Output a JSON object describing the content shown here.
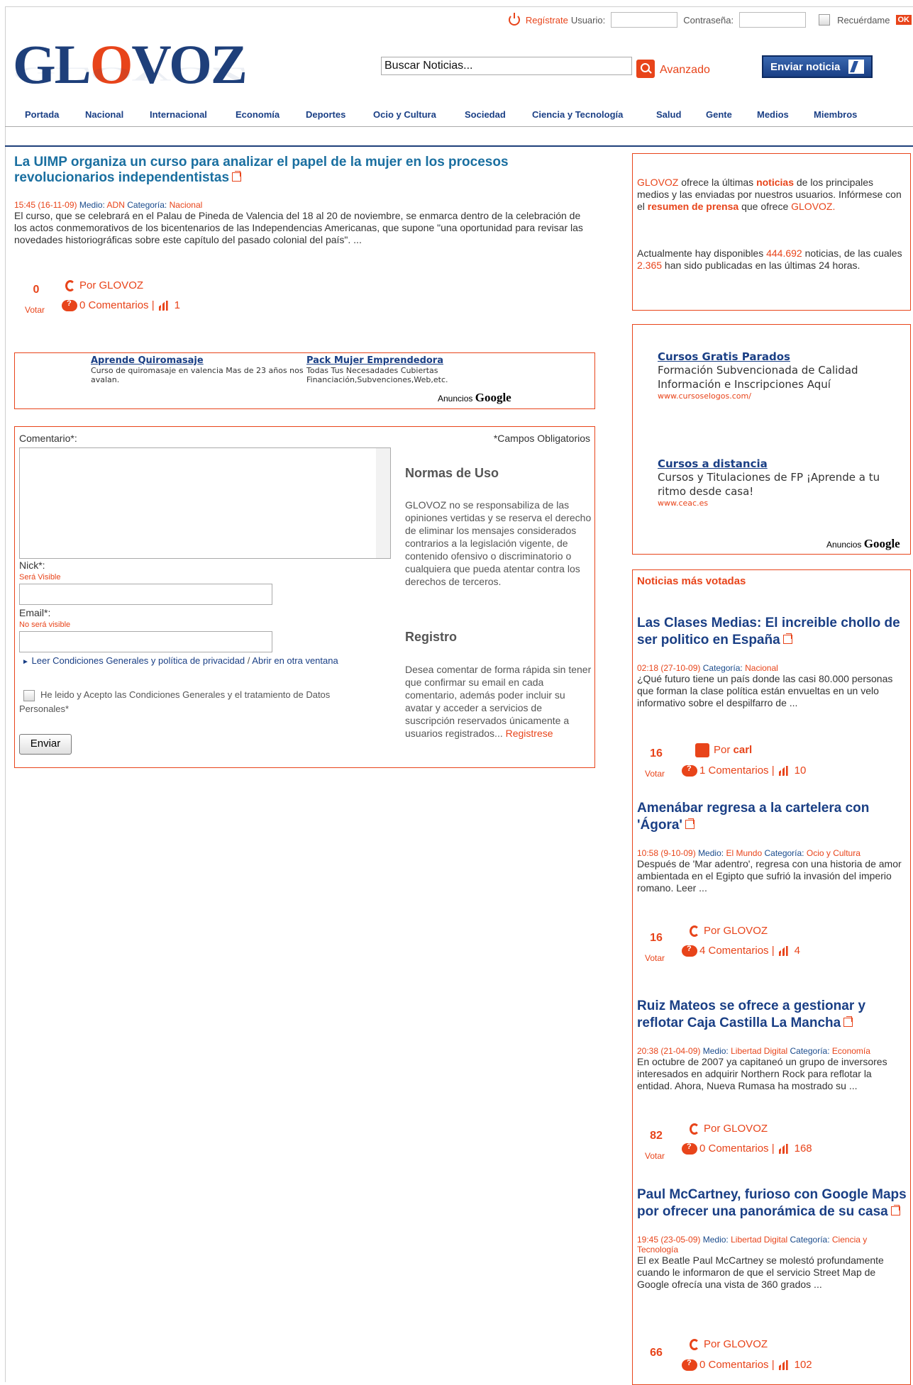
{
  "login": {
    "register": "Regístrate",
    "user_label": "Usuario:",
    "pass_label": "Contraseña:",
    "remember": "Recuérdame",
    "ok": "OK"
  },
  "logo": {
    "pre": "GL",
    "o": "O",
    "post": "VOZ"
  },
  "search": {
    "placeholder": "Buscar Noticias...",
    "advanced": "Avanzado",
    "send": "Enviar noticia"
  },
  "nav": [
    "Portada",
    "Nacional",
    "Internacional",
    "Economía",
    "Deportes",
    "Ocio y Cultura",
    "Sociedad",
    "Ciencia y Tecnología",
    "Salud",
    "Gente",
    "Medios",
    "Miembros"
  ],
  "article": {
    "title": "La UIMP organiza un curso para analizar el papel de la mujer en los procesos revolucionarios independentistas",
    "time": "15:45 (16-11-09)",
    "medio_label": "Medio:",
    "medio": "ADN",
    "cat_label": "Categoría:",
    "category": "Nacional",
    "body": "El curso, que se celebrará en el Palau de Pineda de Valencia del 18 al 20 de noviembre, se enmarca dentro de la celebración de los actos conmemorativos de los bicentenarios de las Independencias Americanas, que supone \"una oportunidad para revisar las novedades historiográficas sobre este capítulo del pasado colonial del país\". ...",
    "votes": "0",
    "votar": "Votar",
    "by": "Por GLOVOZ",
    "comments": "0 Comentarios |",
    "views": "1"
  },
  "ads_main": {
    "ad1_title": "Aprende Quiromasaje",
    "ad1_desc": "Curso de quiromasaje en valencia Mas de 23 años nos avalan.",
    "ad2_title": "Pack Mujer Emprendedora",
    "ad2_desc": "Todas Tus Necesadades Cubiertas Financiación,Subvenciones,Web,etc.",
    "anuncios": "Anuncios",
    "google": "Google"
  },
  "form": {
    "comment_label": "Comentario*:",
    "required": "*Campos Obligatorios",
    "nick_label": "Nick*:",
    "nick_note": "Será Visible",
    "email_label": "Email*:",
    "email_note": "No será visible",
    "conditions": "Leer Condiciones Generales y política de privacidad",
    "open_window": "Abrir en otra ventana",
    "accept": "He leido y Acepto las Condiciones Generales y el tratamiento de Datos Personales",
    "submit": "Enviar",
    "rules_title": "Normas de Uso",
    "rules_text": "GLOVOZ no se responsabiliza de las opiniones vertidas y se reserva el derecho de eliminar los mensajes considerados contrarios a la legislación vigente, de contenido ofensivo o discriminatorio o cualquiera que pueda atentar contra los derechos de terceros.",
    "reg_title": "Registro",
    "reg_text": "Desea comentar de forma rápida sin tener que confirmar su email en cada comentario, además poder incluir su avatar y acceder a servicios de suscripción reservados únicamente a usuarios registrados...",
    "reg_link": "Registrese"
  },
  "info": {
    "p1a": "GLOVOZ",
    "p1b": " ofrece la últimas ",
    "p1c": "noticias",
    "p1d": " de los principales medios y las enviadas por nuestros usuarios. Infórmese con el ",
    "p1e": "resumen de prensa",
    "p1f": " que ofrece ",
    "p1g": "GLOVOZ.",
    "p2a": "Actualmente hay disponibles ",
    "p2b": "444.692",
    "p2c": " noticias, de las cuales ",
    "p2d": "2.365",
    "p2e": " han sido publicadas en las últimas 24 horas."
  },
  "ads_side": {
    "ad1_title": "Cursos Gratis Parados",
    "ad1_desc": "Formación Subvencionada de Calidad Información e Inscripciones Aquí",
    "ad1_url": "www.cursoselogos.com/",
    "ad2_title": "Cursos a distancia",
    "ad2_desc": "Cursos y Titulaciones de FP ¡Aprende a tu ritmo desde casa!",
    "ad2_url": "www.ceac.es",
    "anuncios": "Anuncios",
    "google": "Google"
  },
  "top": {
    "heading": "Noticias más votadas",
    "items": [
      {
        "title": "Las Clases Medias: El increible chollo de ser politico en España",
        "time": "02:18 (27-10-09)",
        "medio": "",
        "cat": "Nacional",
        "snippet": "¿Qué futuro tiene un país donde las casi 80.000 personas que forman la clase política están envueltas en un velo informativo sobre el despilfarro de ...",
        "votes": "16",
        "by": "Por ",
        "user": "carl",
        "comments": "1 Comentarios |",
        "views": "10"
      },
      {
        "title": "Amenábar regresa a la cartelera con 'Ágora'",
        "time": "10:58 (9-10-09)",
        "medio": "El Mundo",
        "cat": "Ocio y Cultura",
        "snippet": "Después de 'Mar adentro', regresa con una historia de amor ambientada en el Egipto que sufrió la invasión del imperio romano.  Leer ...",
        "votes": "16",
        "by": "Por GLOVOZ",
        "user": "",
        "comments": "4 Comentarios |",
        "views": "4"
      },
      {
        "title": "Ruiz Mateos se ofrece a gestionar y reflotar Caja Castilla La Mancha",
        "time": "20:38 (21-04-09)",
        "medio": "Libertad Digital",
        "cat": "Economía",
        "snippet": "En octubre de 2007 ya capitaneó un grupo de inversores interesados en adquirir Northern Rock para reflotar la entidad. Ahora, Nueva Rumasa ha mostrado su ...",
        "votes": "82",
        "by": "Por GLOVOZ",
        "user": "",
        "comments": "0 Comentarios |",
        "views": "168"
      },
      {
        "title": "Paul McCartney, furioso con Google Maps por ofrecer una panorámica de su casa",
        "time": "19:45 (23-05-09)",
        "medio": "Libertad Digital",
        "cat": "Ciencia y Tecnología",
        "snippet": "El ex Beatle Paul McCartney se molestó profundamente cuando le informaron de que el servicio Street Map de Google ofrecía una vista de 360 grados ...",
        "votes": "66",
        "by": "Por GLOVOZ",
        "user": "",
        "comments": "0 Comentarios |",
        "views": "102"
      }
    ],
    "medio_label": "Medio:",
    "cat_label": "Categoría:",
    "votar": "Votar"
  }
}
